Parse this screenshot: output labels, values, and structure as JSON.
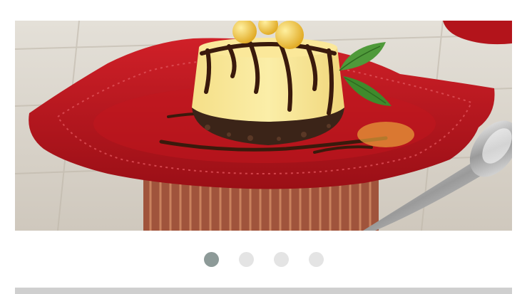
{
  "carousel": {
    "slide_image": "cheesecake-on-red-plate-photo",
    "active_index": 0,
    "slide_count": 4,
    "colors": {
      "active_dot": "#8d9a98",
      "inactive_dot": "#e4e4e4",
      "plate": "#b8141c",
      "table": "#d9d4cc"
    }
  },
  "footer": {
    "bar_color": "#cfcfcf"
  }
}
